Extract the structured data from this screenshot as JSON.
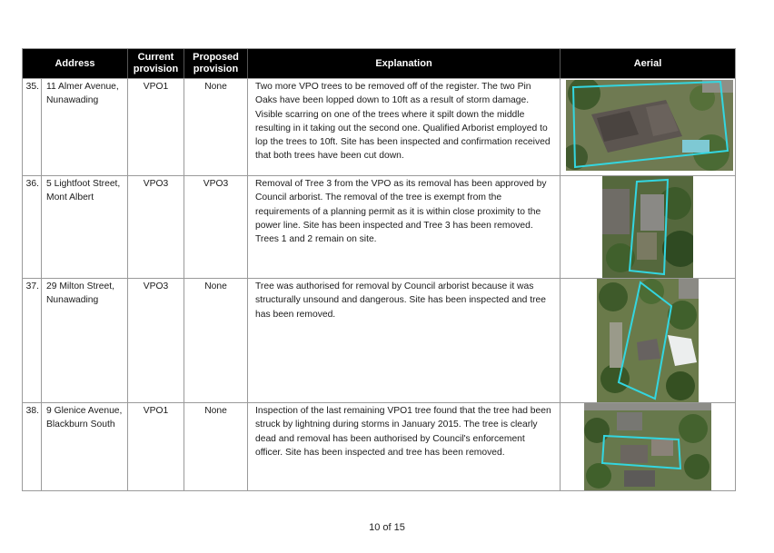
{
  "table": {
    "headers": {
      "address": "Address",
      "current": "Current provision",
      "proposed": "Proposed provision",
      "explanation": "Explanation",
      "aerial": "Aerial"
    },
    "rows": [
      {
        "num": "35.",
        "address": "11 Almer Avenue, Nunawading",
        "current": "VPO1",
        "proposed": "None",
        "explanation": "Two more VPO trees to be removed off of the register. The two Pin Oaks have been lopped down to 10ft as a result of storm damage. Visible scarring on one of the trees where it spilt down the middle resulting in it taking out the second one. Qualified Arborist employed to lop the trees to 10ft. Site has been inspected and confirmation received that both trees have been cut down."
      },
      {
        "num": "36.",
        "address": "5 Lightfoot Street, Mont Albert",
        "current": "VPO3",
        "proposed": "VPO3",
        "explanation": "Removal of Tree 3 from the VPO as its removal has been approved by Council arborist. The removal of the tree is exempt from the requirements of a planning permit as it is within close proximity to the power line.  Site has been inspected and Tree 3 has been removed. Trees 1 and 2 remain on site."
      },
      {
        "num": "37.",
        "address": "29 Milton Street, Nunawading",
        "current": "VPO3",
        "proposed": "None",
        "explanation": "Tree was authorised for removal by Council arborist because it was structurally unsound and dangerous. Site has been inspected and tree has been removed."
      },
      {
        "num": "38.",
        "address": "9 Glenice Avenue, Blackburn South",
        "current": "VPO1",
        "proposed": "None",
        "explanation": "Inspection of the last remaining VPO1 tree found that the tree had been struck by lightning during storms in January 2015.  The tree is clearly dead and removal has been authorised by Council's enforcement officer. Site has been inspected and tree has been removed."
      }
    ]
  },
  "footer": {
    "page": "10 of 15"
  }
}
